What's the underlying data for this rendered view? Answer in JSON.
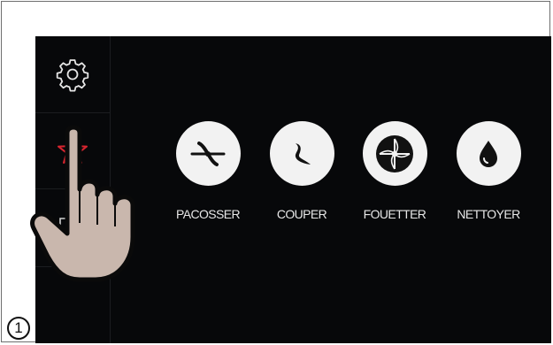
{
  "sidebar": {
    "settings_icon": "gear-icon",
    "favorites_icon": "star-icon",
    "book_icon": "book-icon",
    "favorites_color": "#d9252f"
  },
  "modes": [
    {
      "label": "PACOSSER",
      "icon": "scissor-blade-icon"
    },
    {
      "label": "COUPER",
      "icon": "cut-blade-icon"
    },
    {
      "label": "FOUETTER",
      "icon": "whisk-icon"
    },
    {
      "label": "NETTOYER",
      "icon": "water-drop-icon"
    }
  ],
  "step_marker": "1"
}
